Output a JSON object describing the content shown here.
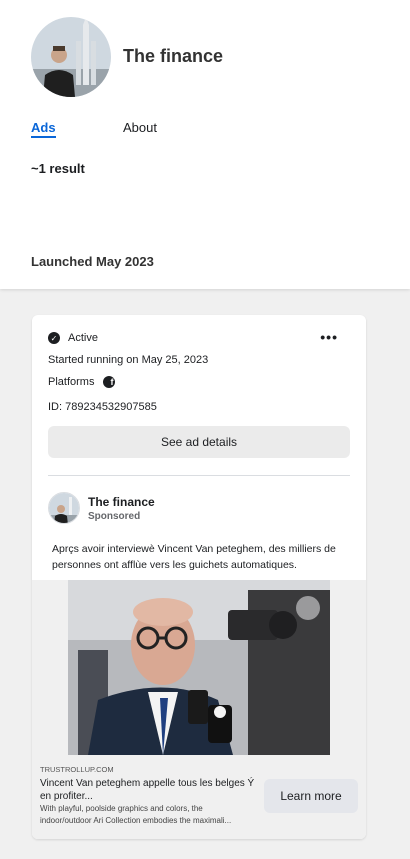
{
  "page": {
    "name": "The finance",
    "tabs": [
      {
        "label": "Ads",
        "active": true
      },
      {
        "label": "About",
        "active": false
      }
    ],
    "result_count": "~1 result",
    "launched": "Launched May 2023",
    "accent_color": "#0a66d8"
  },
  "ad": {
    "status": "Active",
    "started": "Started running on May 25, 2023",
    "platforms_label": "Platforms",
    "platform_icon": "facebook-icon",
    "id": "ID: 789234532907585",
    "details_button": "See ad details",
    "advertiser": "The finance",
    "sponsored": "Sponsored",
    "body_text": "Aprçs avoir interviewè Vincent Van peteghem, des milliers de personnes ont afflùe vers les guichets automatiques.",
    "domain": "TRUSTROLLUP.COM",
    "headline": "Vincent Van peteghem appelle tous les belges Ý en profiter...",
    "description_line1": "With playful, poolside graphics and colors, the",
    "description_line2": "indoor/outdoor Ari Collection embodies the maximali...",
    "cta_button": "Learn more"
  }
}
